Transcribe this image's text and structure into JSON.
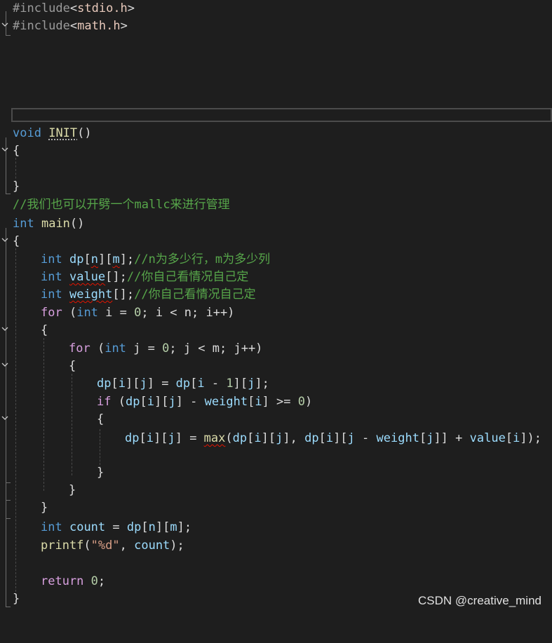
{
  "colors": {
    "background": "#1e1e1e",
    "keyword": "#569cd6",
    "control": "#d8a0df",
    "preprocessor": "#9b9b9b",
    "include_path": "#e8c9bb",
    "function": "#dcdcaa",
    "variable": "#9cdcfe",
    "number": "#b5cea8",
    "string": "#d69d85",
    "comment": "#57a64a",
    "error_squiggle": "#e51400"
  },
  "code": {
    "l1": {
      "pp": "#include",
      "lt": "<",
      "path": "stdio.h",
      "gt": ">"
    },
    "l2": {
      "pp": "#include",
      "lt": "<",
      "path": "math.h",
      "gt": ">"
    },
    "l3": {
      "kw": "void",
      "fn": "INIT",
      "rest": "()"
    },
    "l4": {
      "t": "{"
    },
    "l5": {
      "t": "}"
    },
    "l6": {
      "cm": "//我们也可以开劈一个mallc来进行管理"
    },
    "l7": {
      "kw": "int",
      "fn": "main",
      "rest": "()"
    },
    "l8": {
      "t": "{"
    },
    "l9": {
      "kw": "int",
      "sp": " ",
      "v1": "dp",
      "b1": "[",
      "v2": "n",
      "b2": "][",
      "v3": "m",
      "b3": "];",
      "cm": "//n为多少行，m为多少列"
    },
    "l10": {
      "kw": "int",
      "sp": " ",
      "v1": "value",
      "b1": "[];",
      "cm": "//你自己看情况自己定"
    },
    "l11": {
      "kw": "int",
      "sp": " ",
      "v1": "weight",
      "b1": "[];",
      "cm": "//你自己看情况自己定"
    },
    "l12": {
      "ctl": "for",
      "a": " (",
      "kw": "int",
      "b": " i = ",
      "n0": "0",
      "c": "; i < n; i++)"
    },
    "l13": {
      "t": "{"
    },
    "l14": {
      "ctl": "for",
      "a": " (",
      "kw": "int",
      "b": " j = ",
      "n0": "0",
      "c": "; j < m; j++)"
    },
    "l15": {
      "t": "{"
    },
    "l16": {
      "v1": "dp",
      "a": "[",
      "v2": "i",
      "b": "][",
      "v3": "j",
      "c": "] = ",
      "v4": "dp",
      "d": "[",
      "v5": "i",
      "e": " - ",
      "n1": "1",
      "f": "][",
      "v6": "j",
      "g": "];"
    },
    "l17": {
      "ctl": "if",
      "a": " (",
      "v1": "dp",
      "b": "[",
      "v2": "i",
      "c": "][",
      "v3": "j",
      "d": "] - ",
      "v4": "weight",
      "e": "[",
      "v5": "i",
      "f": "] >= ",
      "n0": "0",
      "g": ")"
    },
    "l18": {
      "t": "{"
    },
    "l19": {
      "v1": "dp",
      "a": "[",
      "v2": "i",
      "b": "][",
      "v3": "j",
      "c": "] = ",
      "fn": "max",
      "d": "(",
      "v4": "dp",
      "e": "[",
      "v5": "i",
      "f": "][",
      "v6": "j",
      "g": "], ",
      "v7": "dp",
      "h": "[",
      "v8": "i",
      "i": "][",
      "v9": "j",
      "j": " - ",
      "v10": "weight",
      "k": "[",
      "v11": "j",
      "l": "]] + ",
      "v12": "value",
      "m": "[",
      "v13": "i",
      "n": "]);"
    },
    "l20": {
      "t": "}"
    },
    "l21": {
      "t": "}"
    },
    "l22": {
      "t": "}"
    },
    "l23": {
      "kw": "int",
      "sp": " ",
      "v1": "count",
      "a": " = ",
      "v2": "dp",
      "b": "[",
      "v3": "n",
      "c": "][",
      "v4": "m",
      "d": "];"
    },
    "l24": {
      "fn": "printf",
      "a": "(",
      "str": "\"%d\"",
      "b": ", ",
      "v1": "count",
      "c": ");"
    },
    "l25": {
      "ctl": "return",
      "sp": " ",
      "n0": "0",
      "a": ";"
    },
    "l26": {
      "t": "}"
    }
  },
  "watermark": "CSDN @creative_mind"
}
